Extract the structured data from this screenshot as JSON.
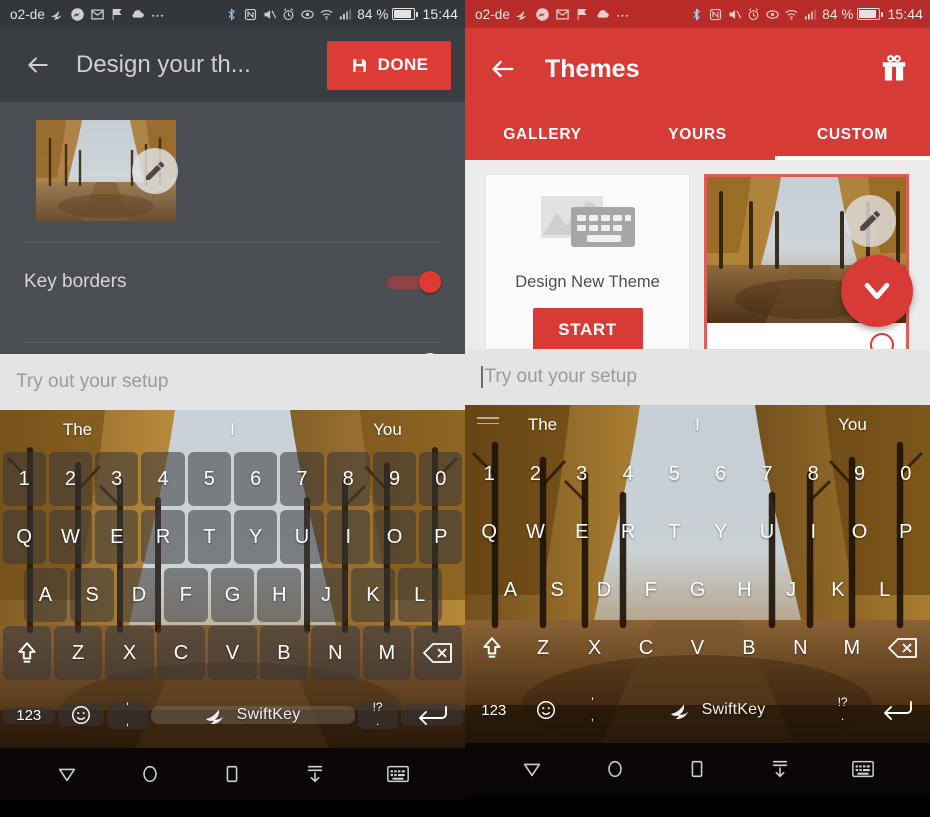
{
  "status_bar": {
    "carrier": "o2-de",
    "battery_percent": "84 %",
    "clock": "15:44",
    "icons": [
      "swiftkey-icon",
      "messenger-icon",
      "gmail-icon",
      "flag-icon",
      "cloud-icon",
      "more-icon"
    ],
    "right_icons": [
      "bluetooth-icon",
      "nfc-icon",
      "mute-icon",
      "alarm-icon",
      "eye-icon",
      "wifi-icon",
      "signal-icon"
    ]
  },
  "left_panel": {
    "appbar": {
      "back_label": "back",
      "title": "Design your th...",
      "done_label": "DONE"
    },
    "thumbnail_alt": "autumn-avenue-theme-preview",
    "settings": [
      {
        "label": "Key borders",
        "enabled": true
      }
    ],
    "input": {
      "placeholder": "Try out your setup",
      "value": ""
    }
  },
  "right_panel": {
    "appbar": {
      "title": "Themes",
      "gift_label": "gift"
    },
    "tabs": [
      {
        "label": "GALLERY",
        "active": false
      },
      {
        "label": "YOURS",
        "active": false
      },
      {
        "label": "CUSTOM",
        "active": true
      }
    ],
    "cards": [
      {
        "type": "new",
        "label": "Design New Theme",
        "button": "START"
      },
      {
        "type": "custom",
        "label": "",
        "selected": true
      }
    ],
    "input": {
      "placeholder": "Try out your setup",
      "value": ""
    }
  },
  "keyboard": {
    "suggestions": [
      "The",
      "I",
      "You"
    ],
    "rows": {
      "digits": [
        "1",
        "2",
        "3",
        "4",
        "5",
        "6",
        "7",
        "8",
        "9",
        "0"
      ],
      "top": [
        "Q",
        "W",
        "E",
        "R",
        "T",
        "Y",
        "U",
        "I",
        "O",
        "P"
      ],
      "home": [
        "A",
        "S",
        "D",
        "F",
        "G",
        "H",
        "J",
        "K",
        "L"
      ],
      "bottom": [
        "Z",
        "X",
        "C",
        "V",
        "B",
        "N",
        "M"
      ]
    },
    "shift_label": "shift",
    "backspace_label": "backspace",
    "numeric_key": "123",
    "emoji_key": "emoji",
    "comma_key_top": "'",
    "comma_key_bottom": ",",
    "period_key_top": "!?",
    "period_key_bottom": ".",
    "space_brand": "SwiftKey",
    "enter_label": "enter"
  },
  "nav_bar": {
    "items": [
      "back-nav-icon",
      "home-nav-icon",
      "recents-nav-icon",
      "hide-keyboard-icon",
      "switch-keyboard-icon"
    ]
  },
  "colors": {
    "accent_red": "#d73b35",
    "status_red": "#b72b29",
    "dark_bar": "#3a3d41",
    "dark_body": "#4a4d51",
    "input_grey": "#e4e4e4",
    "card_bg": "#ececec"
  }
}
